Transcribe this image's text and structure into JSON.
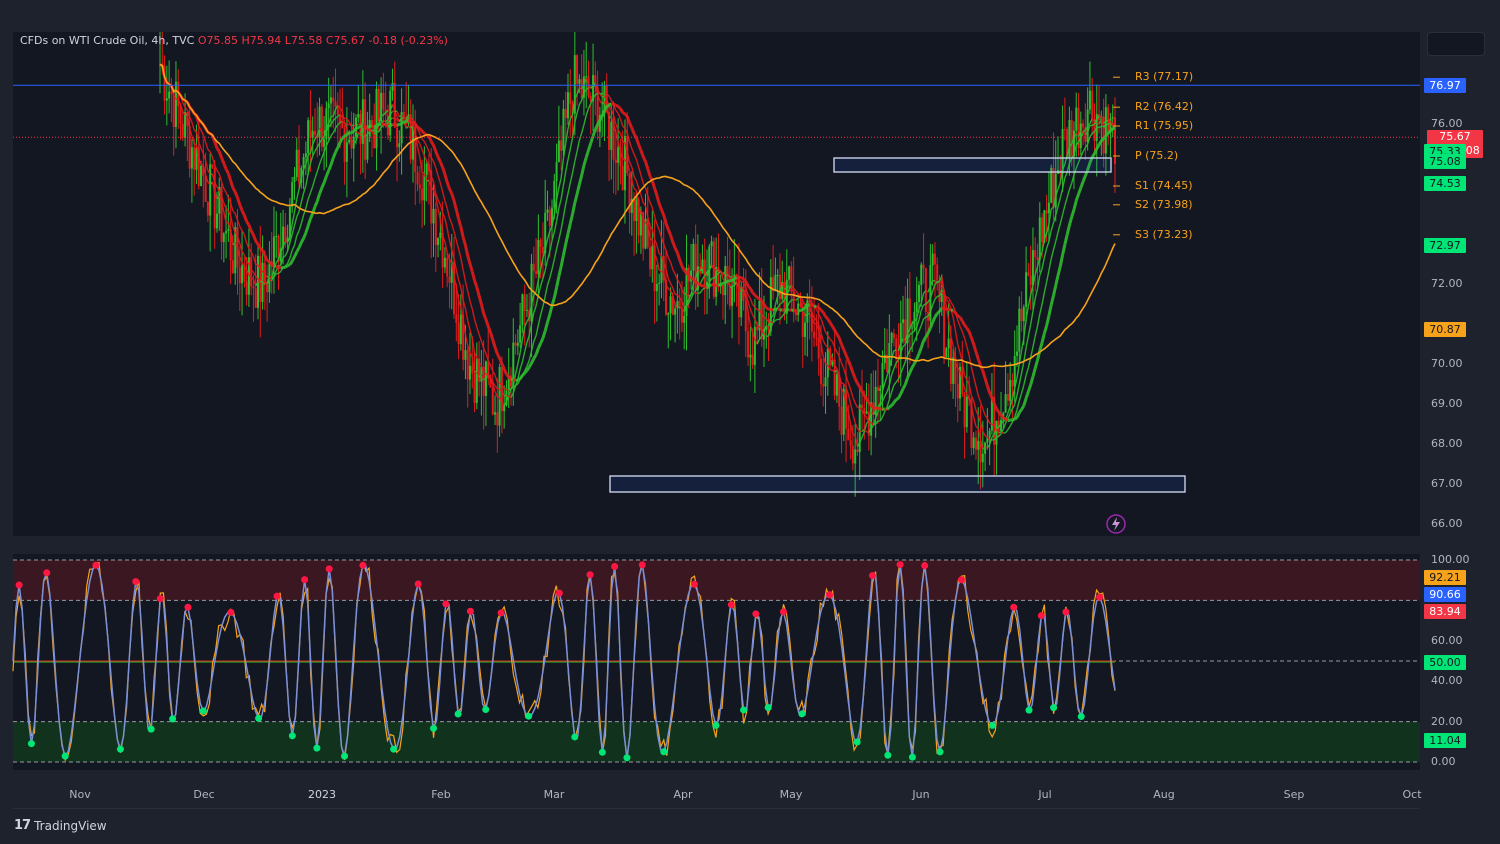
{
  "legend": {
    "symbol": "CFDs on WTI Crude Oil, 4h, TVC",
    "ohlc": "O75.85 H75.94 L75.58 C75.67 -0.18 (-0.23%)"
  },
  "brand": {
    "name": "TradingView",
    "logo_icon": "tradingview-logo-icon"
  },
  "colors": {
    "background": "#131722",
    "up": "#2ebd2e",
    "down": "#e31b1b",
    "orange": "#f7a21b",
    "blue_line": "#2962ff",
    "zone": "#c8d0e8"
  },
  "chart_data": [
    {
      "type": "line",
      "title": "",
      "x": [
        "Nov",
        "Dec",
        "2023",
        "Feb",
        "Mar",
        "Apr",
        "May",
        "Jun",
        "Jul",
        "Aug",
        "Sep",
        "Oct"
      ],
      "y_ticks": [
        "76.00",
        "72.00",
        "70.00",
        "69.00",
        "68.00",
        "67.00",
        "66.00"
      ],
      "ylim": [
        65.7,
        78.3
      ],
      "price_badges": [
        {
          "value": "76.97",
          "color": "#2962ff",
          "text_color": "#ffffff"
        },
        {
          "value": "75.67",
          "sub": "02:36:08",
          "color": "#f23645",
          "text_color": "#ffffff"
        },
        {
          "value": "75.33",
          "color": "#00e676",
          "text_color": "#131722"
        },
        {
          "value": "75.08",
          "color": "#00e676",
          "text_color": "#131722"
        },
        {
          "value": "74.53",
          "color": "#00e676",
          "text_color": "#131722"
        },
        {
          "value": "72.97",
          "color": "#00e676",
          "text_color": "#131722"
        },
        {
          "value": "70.87",
          "color": "#f7a21b",
          "text_color": "#131722"
        }
      ],
      "pivots": [
        {
          "label": "R3 (77.17)",
          "value": 77.17
        },
        {
          "label": "R2 (76.42)",
          "value": 76.42
        },
        {
          "label": "R1 (75.95)",
          "value": 75.95
        },
        {
          "label": "P (75.2)",
          "value": 75.2
        },
        {
          "label": "S1 (74.45)",
          "value": 74.45
        },
        {
          "label": "S2 (73.98)",
          "value": 73.98
        },
        {
          "label": "S3 (73.23)",
          "value": 73.23
        }
      ],
      "horizontal_lines": [
        76.97,
        75.67
      ],
      "zones": [
        {
          "from": "May",
          "to": "Jul",
          "low": 74.8,
          "high": 75.15
        },
        {
          "from": "Mar",
          "to": "Aug",
          "low": 66.8,
          "high": 67.2
        }
      ],
      "series": [
        {
          "values": [
            77.5,
            75.8,
            74.2,
            72.5,
            71.9,
            74.0,
            76.1,
            75.8,
            75.9,
            76.4,
            75.2,
            73.0,
            70.0,
            69.0,
            71.0,
            73.2,
            77.0,
            76.5,
            75.0,
            72.5,
            71.5,
            72.8,
            72.0,
            70.5,
            72.0,
            71.2,
            69.5,
            68.0,
            70.0,
            71.5,
            72.0,
            69.2,
            68.0,
            70.0,
            73.0,
            75.5,
            76.5,
            75.67
          ]
        }
      ]
    },
    {
      "type": "line",
      "title": "",
      "x": [
        "Nov",
        "Dec",
        "2023",
        "Feb",
        "Mar",
        "Apr",
        "May",
        "Jun",
        "Jul",
        "Aug",
        "Sep",
        "Oct"
      ],
      "y_ticks": [
        "100.00",
        "60.00",
        "40.00",
        "20.00",
        "0.00"
      ],
      "ylim": [
        0,
        100
      ],
      "levels": [
        100,
        80,
        50,
        20,
        0
      ],
      "badges": [
        {
          "value": "92.21",
          "color": "#f7a21b"
        },
        {
          "value": "90.66",
          "color": "#2962ff"
        },
        {
          "value": "83.94",
          "color": "#f23645"
        },
        {
          "value": "50.00",
          "color": "#00e676"
        },
        {
          "value": "11.04",
          "color": "#00e676"
        }
      ]
    }
  ]
}
